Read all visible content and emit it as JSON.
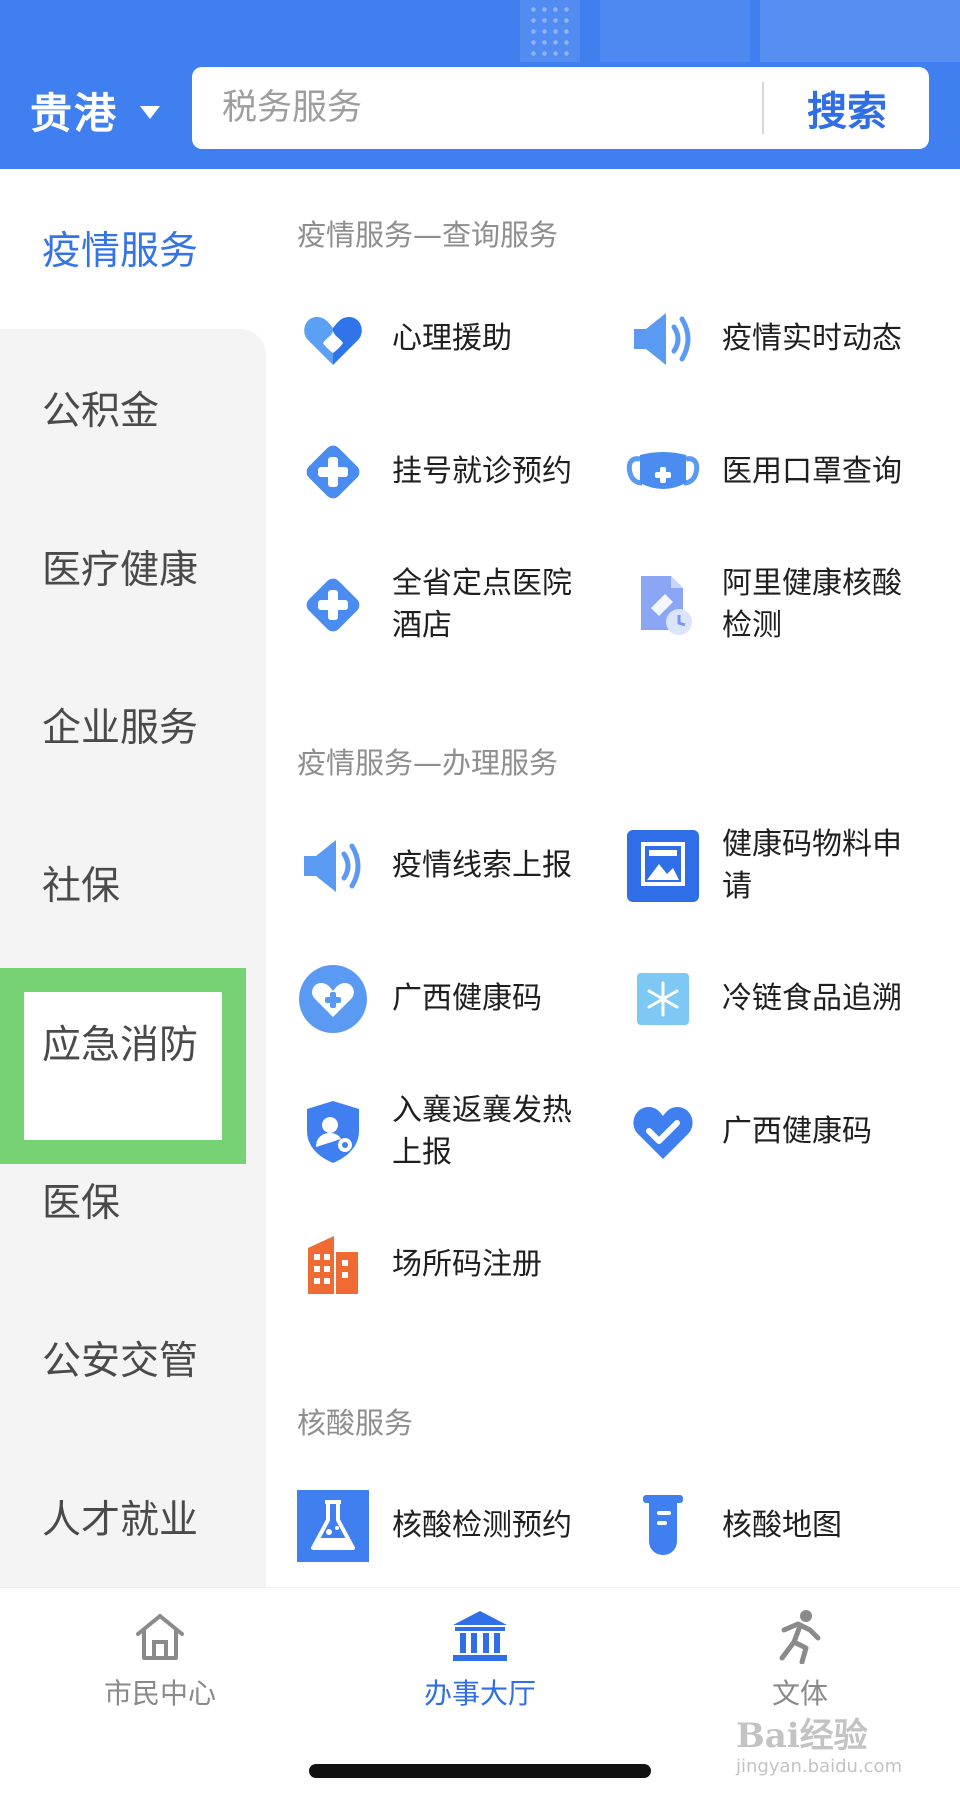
{
  "header": {
    "city": "贵港",
    "search_placeholder": "税务服务",
    "search_button": "搜索"
  },
  "sidebar": {
    "items": [
      "疫情服务",
      "公积金",
      "医疗健康",
      "企业服务",
      "社保",
      "应急消防",
      "医保",
      "公安交管",
      "人才就业"
    ],
    "active_index": 0
  },
  "sections": [
    {
      "title": "疫情服务—查询服务",
      "items": [
        {
          "label": "心理援助",
          "icon": "heart-hands-icon"
        },
        {
          "label": "疫情实时动态",
          "icon": "speaker-icon"
        },
        {
          "label": "挂号就诊预约",
          "icon": "medical-cross-icon"
        },
        {
          "label": "医用口罩查询",
          "icon": "face-mask-icon"
        },
        {
          "label": "全省定点医院酒店",
          "icon": "medical-cross-icon"
        },
        {
          "label": "阿里健康核酸检测",
          "icon": "test-report-clock-icon"
        }
      ]
    },
    {
      "title": "疫情服务—办理服务",
      "items": [
        {
          "label": "疫情线索上报",
          "icon": "speaker-icon"
        },
        {
          "label": "健康码物料申请",
          "icon": "picture-frame-icon"
        },
        {
          "label": "广西健康码",
          "icon": "heart-plus-icon"
        },
        {
          "label": "冷链食品追溯",
          "icon": "snowflake-icon"
        },
        {
          "label": "入襄返襄发热上报",
          "icon": "shield-user-icon"
        },
        {
          "label": "广西健康码",
          "icon": "heart-check-icon"
        },
        {
          "label": "场所码注册",
          "icon": "building-icon"
        }
      ]
    },
    {
      "title": "核酸服务",
      "items": [
        {
          "label": "核酸检测预约",
          "icon": "flask-icon"
        },
        {
          "label": "核酸地图",
          "icon": "test-tube-icon"
        }
      ]
    }
  ],
  "bottom_nav": {
    "items": [
      {
        "label": "市民中心",
        "icon": "home-icon"
      },
      {
        "label": "办事大厅",
        "icon": "government-hall-icon"
      },
      {
        "label": "文体",
        "icon": "running-person-icon"
      }
    ],
    "active_index": 1
  },
  "watermark": {
    "brand": "Bai经验",
    "url": "jingyan.baidu.com"
  },
  "colors": {
    "primary": "#3f7ff0",
    "active_text": "#3474e6",
    "highlight_box": "#77d274",
    "building_icon": "#f06a33",
    "sidebar_bg": "#f4f4f4"
  }
}
